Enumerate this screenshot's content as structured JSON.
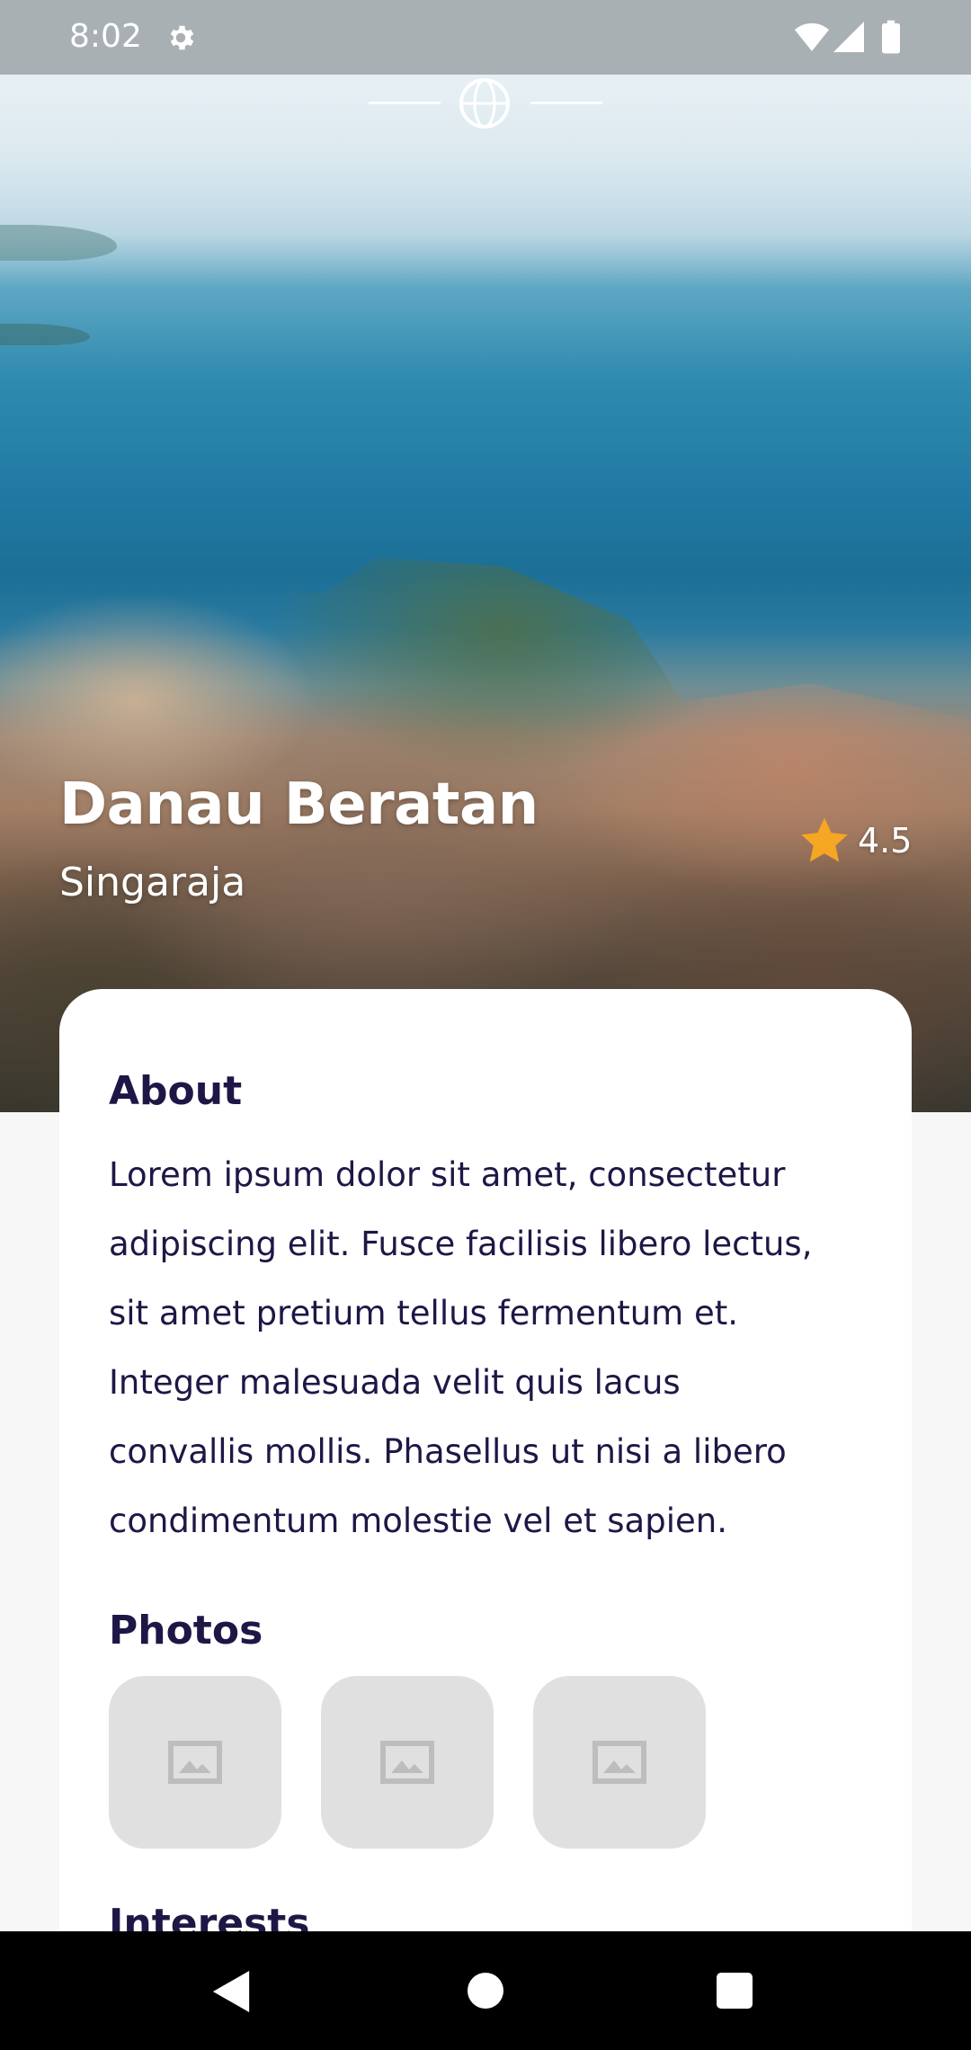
{
  "status_bar": {
    "time": "8:02"
  },
  "place": {
    "name": "Danau Beratan",
    "location": "Singaraja",
    "rating": "4.5"
  },
  "about": {
    "title": "About",
    "lines": [
      "Lorem ipsum dolor sit amet, consectetur",
      "adipiscing elit. Fusce facilisis libero lectus,",
      "sit amet pretium tellus fermentum et.",
      "Integer malesuada velit quis lacus",
      "convallis mollis. Phasellus ut nisi a libero",
      "condimentum molestie vel et sapien."
    ]
  },
  "photos": {
    "title": "Photos",
    "items": [
      "image-placeholder-icon",
      "image-placeholder-icon",
      "image-placeholder-icon"
    ]
  },
  "interests": {
    "title": "Interests"
  },
  "colors": {
    "text_dark": "#1e1746",
    "star": "#f5a623",
    "placeholder": "#e0e0e0"
  }
}
